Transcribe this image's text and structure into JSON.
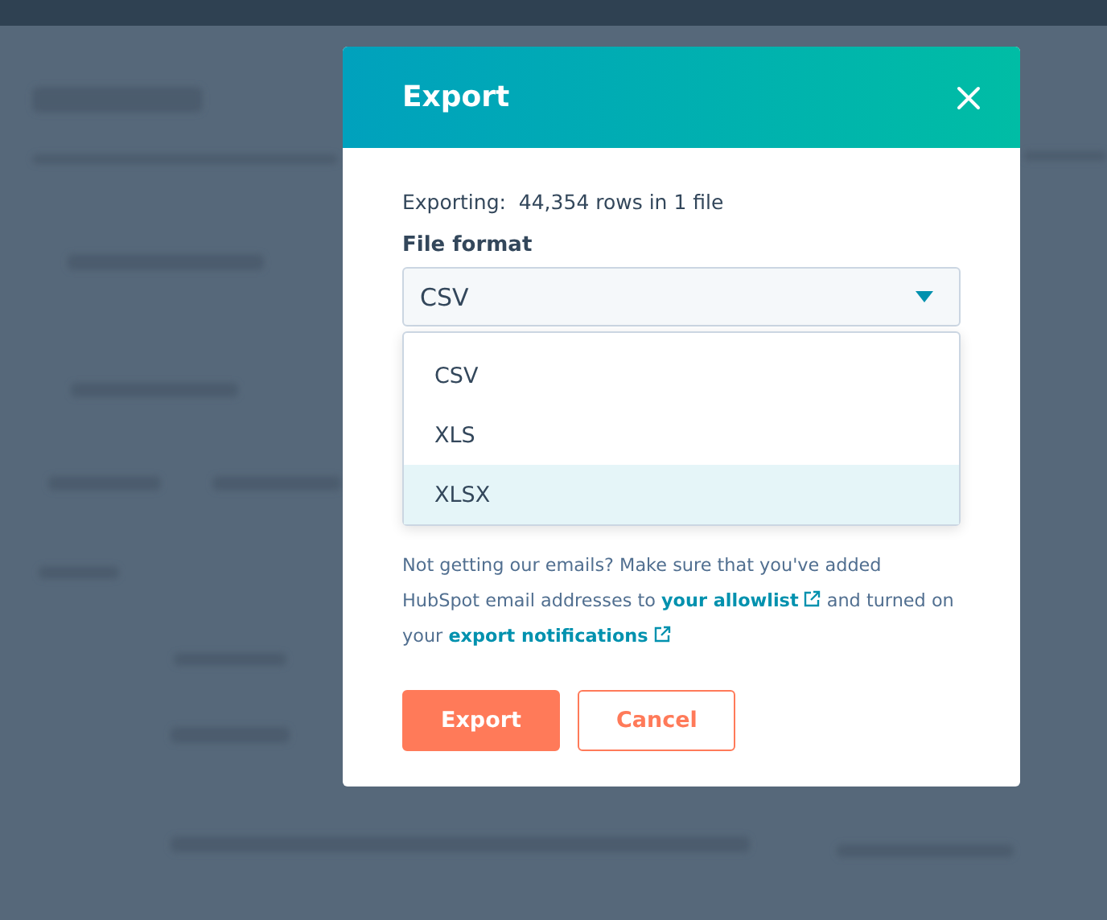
{
  "dialog": {
    "title": "Export",
    "summary": "Exporting:  44,354 rows in 1 file",
    "file_format": {
      "label": "File format",
      "value": "CSV",
      "expanded": true,
      "options": [
        {
          "label": "CSV",
          "highlighted": false
        },
        {
          "label": "XLS",
          "highlighted": false
        },
        {
          "label": "XLSX",
          "highlighted": true
        }
      ]
    },
    "notice": [
      {
        "kind": "text",
        "text": "Not getting our emails? Make sure that you've added HubSpot email addresses to "
      },
      {
        "kind": "link",
        "text": "your allowlist"
      },
      {
        "kind": "text",
        "text": " and turned on your "
      },
      {
        "kind": "link",
        "text": "export notifications"
      }
    ],
    "buttons": [
      {
        "label": "Export",
        "kind": "primary"
      },
      {
        "label": "Cancel",
        "kind": "secondary"
      }
    ]
  }
}
